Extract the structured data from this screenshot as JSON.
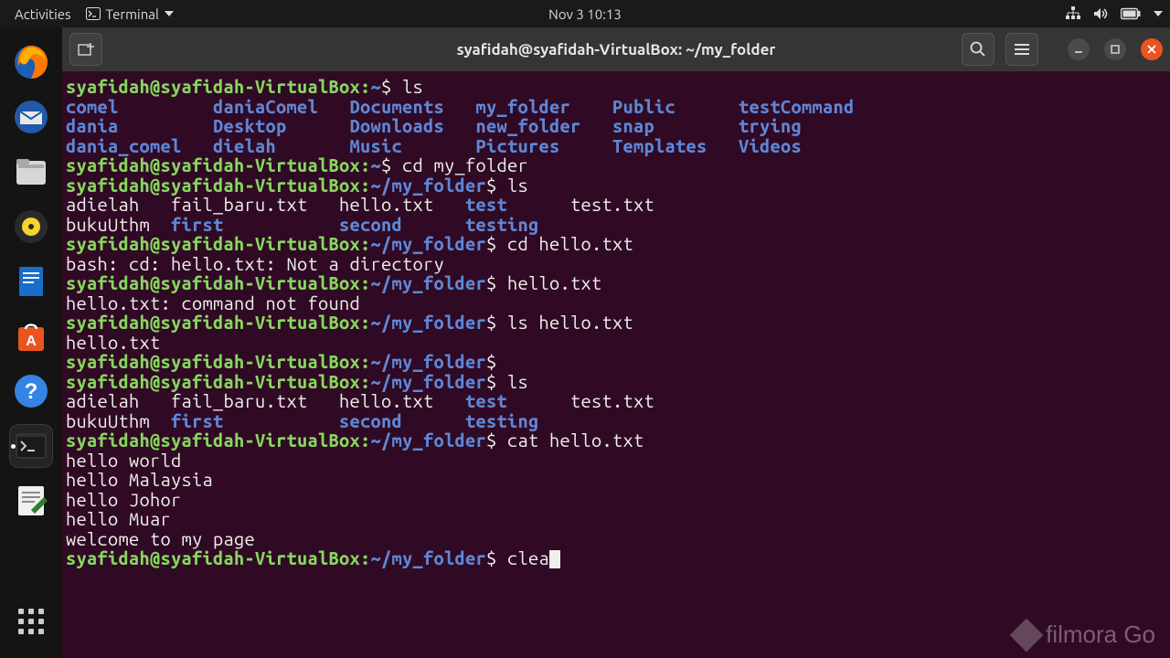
{
  "topbar": {
    "activities": "Activities",
    "appmenu": "Terminal",
    "clock": "Nov 3  10:13"
  },
  "window": {
    "title": "syafidah@syafidah-VirtualBox: ~/my_folder"
  },
  "prompt": {
    "user": "syafidah@syafidah-VirtualBox",
    "home": "~",
    "folder": "~/my_folder"
  },
  "cmds": {
    "ls": "ls",
    "cd_my_folder": "cd my_folder",
    "cd_hello": "cd hello.txt",
    "hello_txt": "hello.txt",
    "ls_hello": "ls hello.txt",
    "cat_hello": "cat hello.txt",
    "clea": "clea"
  },
  "home_listing": {
    "r1": {
      "c1": "comel",
      "c2": "daniaComel",
      "c3": "Documents",
      "c4": "my_folder",
      "c5": "Public",
      "c6": "testCommand"
    },
    "r2": {
      "c1": "dania",
      "c2": "Desktop",
      "c3": "Downloads",
      "c4": "new_folder",
      "c5": "snap",
      "c6": "trying"
    },
    "r3": {
      "c1": "dania_comel",
      "c2": "dielah",
      "c3": "Music",
      "c4": "Pictures",
      "c5": "Templates",
      "c6": "Videos"
    }
  },
  "folder_listing": {
    "r1": {
      "c1": "adielah",
      "c2": "fail_baru.txt",
      "c3": "hello.txt",
      "c4": "test",
      "c5": "test.txt"
    },
    "r2": {
      "c1": "bukuUthm",
      "c2": "first",
      "c3": "second",
      "c4": "testing"
    }
  },
  "errors": {
    "cd_err": "bash: cd: hello.txt: Not a directory",
    "cmd_err": "hello.txt: command not found"
  },
  "out": {
    "hello": "hello.txt"
  },
  "cat_out": {
    "l1": "hello world",
    "l2": "hello Malaysia",
    "l3": "hello Johor",
    "l4": "hello Muar",
    "l5": "welcome to my page"
  },
  "watermark": "filmora Go"
}
